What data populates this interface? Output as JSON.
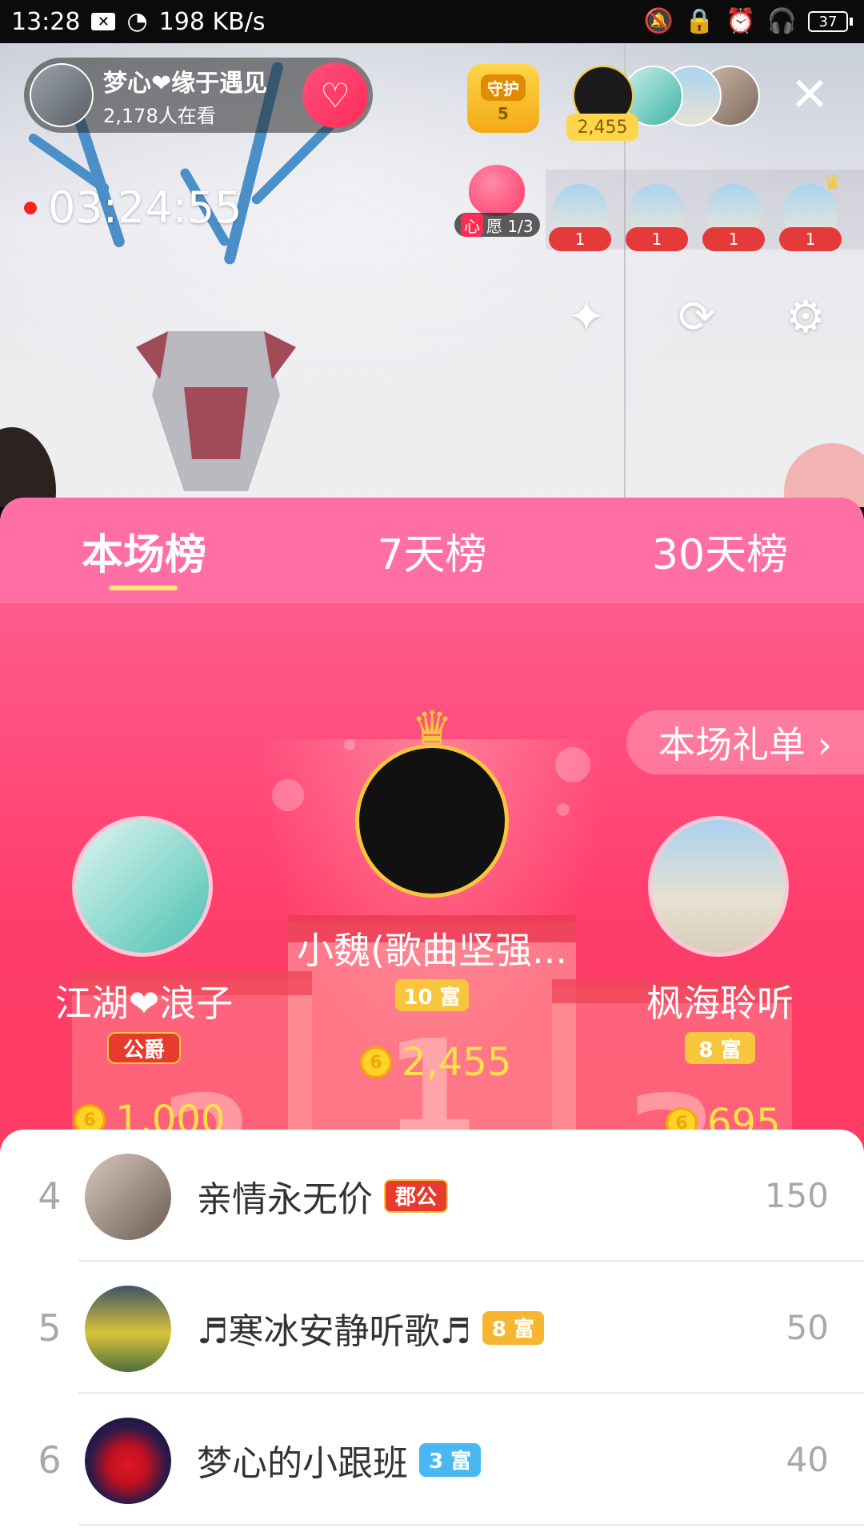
{
  "status_bar": {
    "time": "13:28",
    "net_speed": "198 KB/s",
    "battery": "37"
  },
  "live": {
    "host_name": "梦心❤缘于遇见",
    "viewers": "2,178人在看",
    "guard_label": "守护",
    "guard_count": "5",
    "top_fan_score": "2,455",
    "timer": "03:24:55",
    "wish_tag": "心",
    "wish_text": "愿 1/3",
    "fan_counts": [
      "1",
      "1",
      "1",
      "1"
    ]
  },
  "ranking": {
    "tabs": [
      "本场榜",
      "7天榜",
      "30天榜"
    ],
    "active_tab": 0,
    "gift_list_label": "本场礼单 ›",
    "podium": {
      "first": {
        "name": "小魏(歌曲坚强...",
        "badge": "10 富",
        "coins": "2,455"
      },
      "second": {
        "name": "江湖❤浪子",
        "badge": "公爵",
        "coins": "1,000"
      },
      "third": {
        "name": "枫海聆听",
        "badge": "8 富",
        "coins": "695"
      }
    },
    "podium_numbers": [
      "2",
      "1",
      "3"
    ],
    "coin_symbol": "6",
    "list": [
      {
        "rank": "4",
        "name": "亲情永无价",
        "badge": "郡公",
        "badge_color": "#e63b2e",
        "score": "150"
      },
      {
        "rank": "5",
        "name": "♬寒冰安静听歌♬",
        "badge": "8 富",
        "badge_color": "#f7b531",
        "score": "50"
      },
      {
        "rank": "6",
        "name": "梦心的小跟班",
        "badge": "3 富",
        "badge_color": "#4ab8f0",
        "score": "40"
      }
    ]
  },
  "colors": {
    "accent_pink": "#ff4e85",
    "gold": "#f7c63d"
  }
}
